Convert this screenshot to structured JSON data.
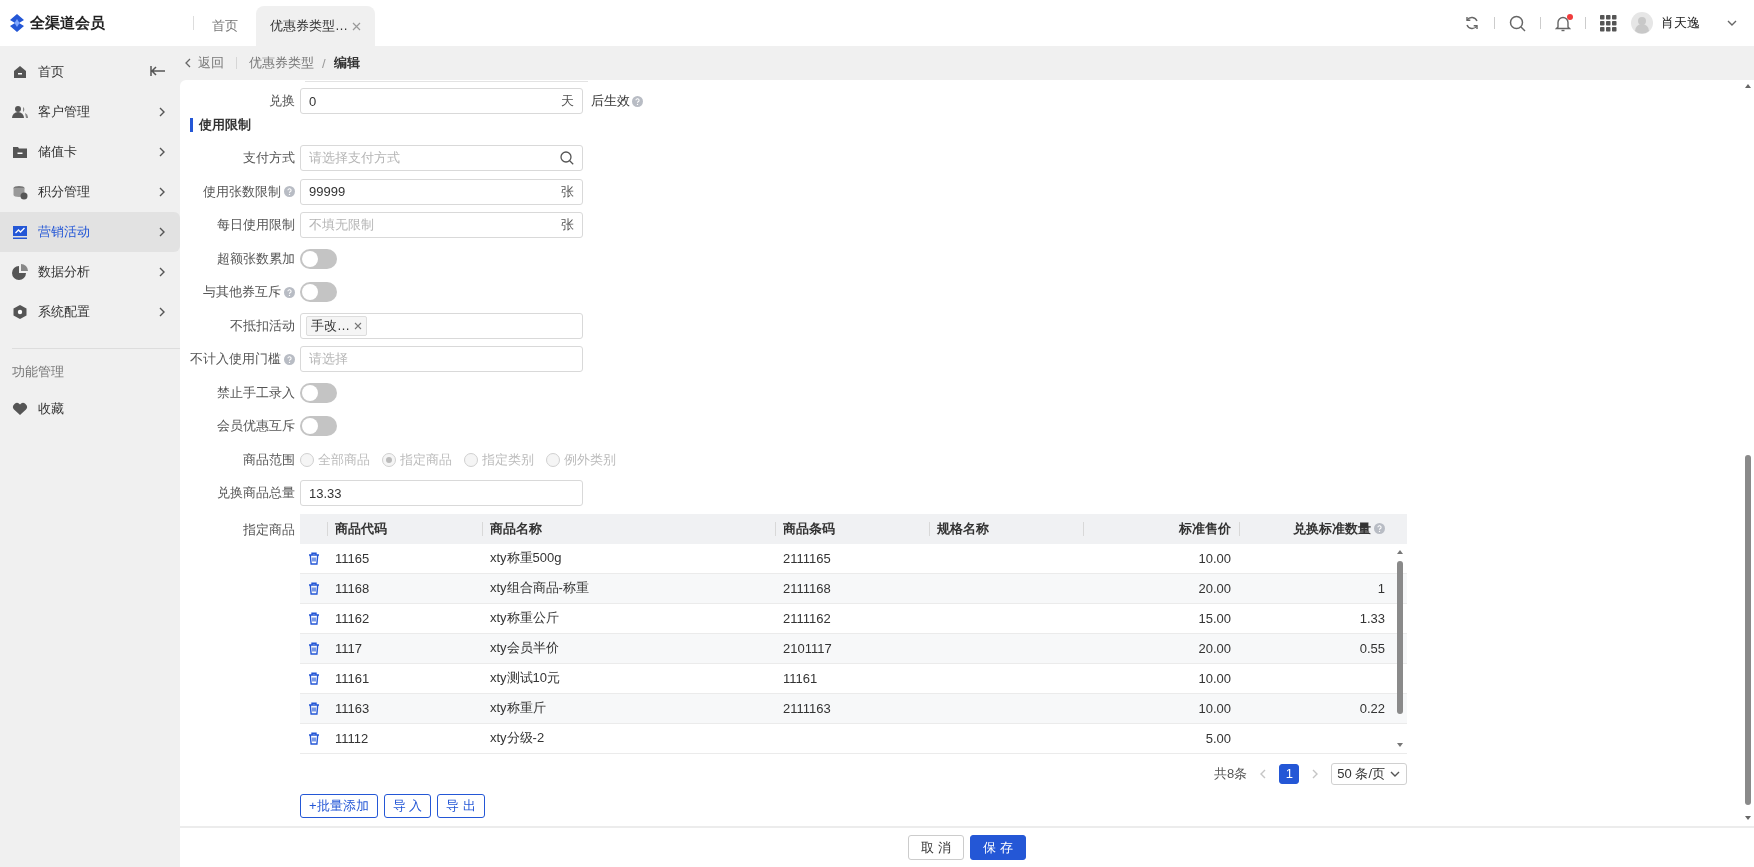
{
  "app": {
    "logo": "全渠道会员"
  },
  "tabs": [
    {
      "label": "首页",
      "selected": false,
      "closable": false
    },
    {
      "label": "优惠券类型…",
      "selected": true,
      "closable": true
    }
  ],
  "header": {
    "notification": true,
    "user": "肖天逸"
  },
  "sidebar": {
    "items": [
      {
        "label": "首页",
        "selected": false,
        "expandable": false
      },
      {
        "label": "客户管理",
        "selected": false,
        "expandable": true
      },
      {
        "label": "储值卡",
        "selected": false,
        "expandable": true
      },
      {
        "label": "积分管理",
        "selected": false,
        "expandable": true
      },
      {
        "label": "营销活动",
        "selected": true,
        "expandable": true
      },
      {
        "label": "数据分析",
        "selected": false,
        "expandable": true
      },
      {
        "label": "系统配置",
        "selected": false,
        "expandable": true
      }
    ],
    "section": "功能管理",
    "extra_items": [
      {
        "label": "收藏",
        "selected": false
      }
    ]
  },
  "breadcrumb": {
    "back": "返回",
    "separator": "/",
    "path": [
      {
        "label": "优惠券类型",
        "current": false
      },
      {
        "label": "编辑",
        "current": true
      }
    ]
  },
  "form": {
    "rows": [
      {
        "kind": "input",
        "label": "兑换",
        "help": false,
        "value": "0",
        "suffix": "天",
        "after": "后生效",
        "after_help": true
      },
      {
        "kind": "section",
        "label": "使用限制"
      },
      {
        "kind": "search",
        "label": "支付方式",
        "help": false,
        "placeholder": "请选择支付方式"
      },
      {
        "kind": "input",
        "label": "使用张数限制",
        "help": true,
        "value": "99999",
        "suffix": "张"
      },
      {
        "kind": "input",
        "label": "每日使用限制",
        "help": false,
        "placeholder": "不填无限制",
        "suffix": "张"
      },
      {
        "kind": "switch",
        "label": "超额张数累加",
        "help": false,
        "on": false
      },
      {
        "kind": "switch",
        "label": "与其他券互斥",
        "help": true,
        "on": false
      },
      {
        "kind": "tags",
        "label": "不抵扣活动",
        "help": false,
        "tags": [
          "手改…"
        ]
      },
      {
        "kind": "select",
        "label": "不计入使用门槛",
        "help": true,
        "placeholder": "请选择"
      },
      {
        "kind": "switch",
        "label": "禁止手工录入",
        "help": false,
        "on": false
      },
      {
        "kind": "switch",
        "label": "会员优惠互斥",
        "help": false,
        "on": false
      },
      {
        "kind": "radio",
        "label": "商品范围",
        "help": false,
        "disabled": true,
        "options": [
          {
            "label": "全部商品",
            "selected": false
          },
          {
            "label": "指定商品",
            "selected": true
          },
          {
            "label": "指定类别",
            "selected": false
          },
          {
            "label": "例外类别",
            "selected": false
          }
        ]
      },
      {
        "kind": "input",
        "label": "兑换商品总量",
        "help": false,
        "value": "13.33"
      },
      {
        "kind": "table",
        "label": "指定商品",
        "help": false,
        "columns": [
          {
            "kind": "text",
            "label": "商品代码",
            "help": false
          },
          {
            "kind": "text",
            "label": "商品名称",
            "help": false
          },
          {
            "kind": "text",
            "label": "商品条码",
            "help": false
          },
          {
            "kind": "text",
            "label": "规格名称",
            "help": false
          },
          {
            "kind": "number",
            "label": "标准售价",
            "help": false
          },
          {
            "kind": "number",
            "label": "兑换标准数量",
            "help": true
          }
        ],
        "rows": [
          {
            "cells": [
              "11165",
              "xty称重500g",
              "2111165",
              null,
              "10.00",
              null
            ]
          },
          {
            "cells": [
              "11168",
              "xty组合商品-称重",
              "2111168",
              null,
              "20.00",
              "1"
            ]
          },
          {
            "cells": [
              "11162",
              "xty称重公斤",
              "2111162",
              null,
              "15.00",
              "1.33"
            ]
          },
          {
            "cells": [
              "1117",
              "xty会员半价",
              "2101117",
              null,
              "20.00",
              "0.55"
            ]
          },
          {
            "cells": [
              "11161",
              "xty测试10元",
              "11161",
              null,
              "10.00",
              null
            ]
          },
          {
            "cells": [
              "11163",
              "xty称重斤",
              "2111163",
              null,
              "10.00",
              "0.22"
            ]
          },
          {
            "cells": [
              "11112",
              "xty分级-2",
              null,
              null,
              "5.00",
              null
            ]
          }
        ],
        "pagination": {
          "total": "共8条",
          "pages": [
            {
              "label": "1",
              "selected": true
            }
          ],
          "page_size": "50 条/页"
        },
        "actions": [
          "+批量添加",
          "导 入",
          "导 出"
        ]
      }
    ]
  },
  "footer": {
    "buttons": [
      {
        "label": "取 消",
        "kind": "default"
      },
      {
        "label": "保 存",
        "kind": "primary"
      }
    ]
  }
}
